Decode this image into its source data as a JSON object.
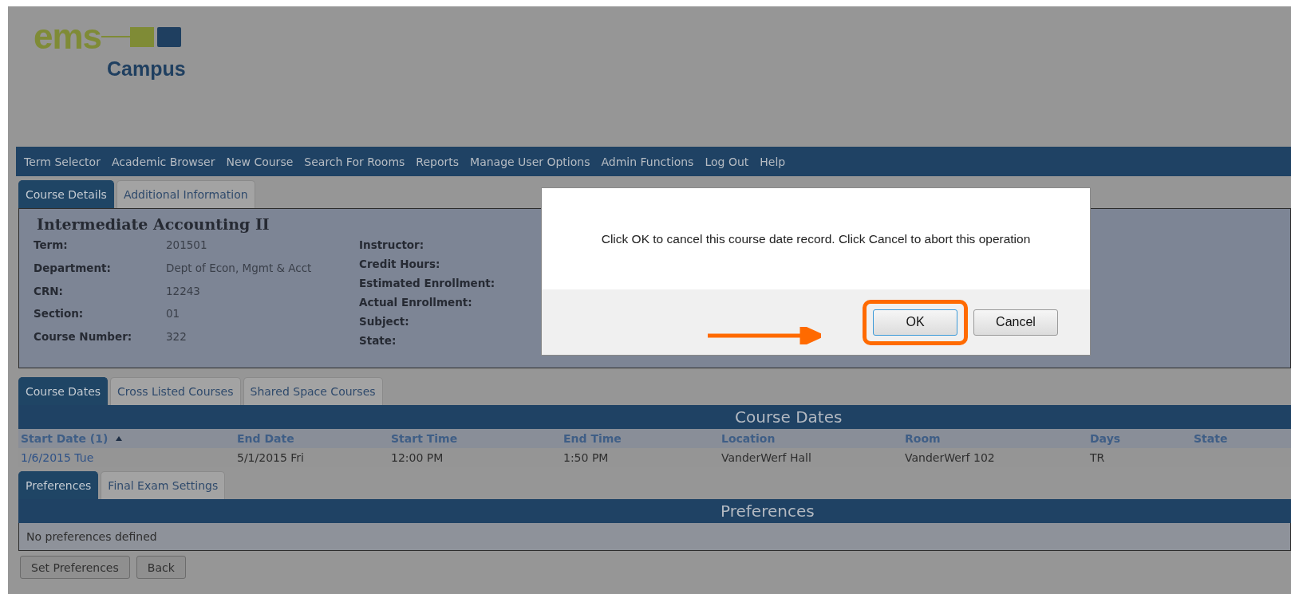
{
  "logo": {
    "mark": "ems",
    "name": "Campus"
  },
  "nav": [
    "Term Selector",
    "Academic Browser",
    "New Course",
    "Search For Rooms",
    "Reports",
    "Manage User Options",
    "Admin Functions",
    "Log Out",
    "Help"
  ],
  "detail_tabs": [
    {
      "label": "Course Details",
      "selected": true
    },
    {
      "label": "Additional Information",
      "selected": false
    }
  ],
  "course": {
    "title": "Intermediate Accounting II",
    "fields_left": [
      {
        "label": "Term:",
        "value": "201501"
      },
      {
        "label": "Department:",
        "value": "Dept of Econ, Mgmt & Acct"
      },
      {
        "label": "CRN:",
        "value": "12243"
      },
      {
        "label": "Section:",
        "value": "01"
      },
      {
        "label": "Course Number:",
        "value": "322"
      }
    ],
    "fields_right": [
      "Instructor:",
      "Credit Hours:",
      "Estimated Enrollment:",
      "Actual Enrollment:",
      "Subject:",
      "State:"
    ]
  },
  "date_tabs": [
    {
      "label": "Course Dates",
      "selected": true
    },
    {
      "label": "Cross Listed Courses",
      "selected": false
    },
    {
      "label": "Shared Space Courses",
      "selected": false
    }
  ],
  "course_dates": {
    "title": "Course Dates",
    "columns": [
      {
        "label": "Start Date (1)",
        "sorted": true
      },
      {
        "label": "End Date",
        "sorted": false
      },
      {
        "label": "Start Time",
        "sorted": false
      },
      {
        "label": "End Time",
        "sorted": false
      },
      {
        "label": "Location",
        "sorted": false
      },
      {
        "label": "Room",
        "sorted": false
      },
      {
        "label": "Days",
        "sorted": false
      },
      {
        "label": "State",
        "sorted": false
      }
    ],
    "rows": [
      [
        "1/6/2015 Tue",
        "5/1/2015 Fri",
        "12:00 PM",
        "1:50 PM",
        "VanderWerf Hall",
        "VanderWerf 102",
        "TR"
      ]
    ]
  },
  "pref_tabs": [
    {
      "label": "Preferences",
      "selected": true
    },
    {
      "label": "Final Exam Settings",
      "selected": false
    }
  ],
  "preferences": {
    "title": "Preferences",
    "message": "No preferences defined"
  },
  "buttons": [
    "Set Preferences",
    "Back"
  ],
  "dialog": {
    "message": "Click OK to cancel this course date record. Click Cancel to abort this operation",
    "buttons": [
      {
        "label": "OK",
        "highlighted": true
      },
      {
        "label": "Cancel",
        "highlighted": false
      }
    ]
  }
}
